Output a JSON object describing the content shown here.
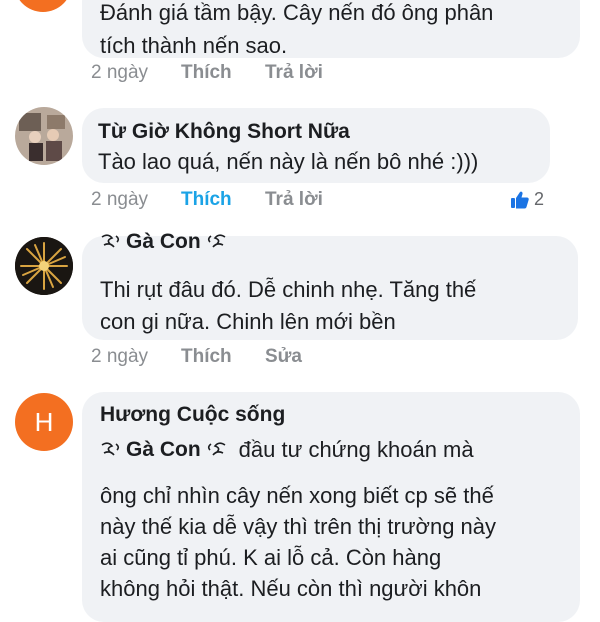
{
  "comments": [
    {
      "author": "",
      "text_lines": [
        "Đánh giá tầm bậy. Cây nến đó ông phân",
        "tích thành nến sao."
      ],
      "time": "2 ngày",
      "like_label": "Thích",
      "reply_label": "Trả lời"
    },
    {
      "author": "Từ Giờ Không Short Nữa",
      "text": "Tào lao quá, nến này là nến bô nhé :)))",
      "time": "2 ngày",
      "like_label": "Thích",
      "reply_label": "Trả lời",
      "reaction_count": "2"
    },
    {
      "mention": "Gà Con",
      "text_lines": [
        "Thi rụt đâu đó. Dễ chinh nhẹ. Tăng thế",
        "con gi nữa. Chinh lên mới bền"
      ],
      "time": "2 ngày",
      "like_label": "Thích",
      "edit_label": "Sửa"
    },
    {
      "avatar_letter": "H",
      "author": "Hương Cuộc sống",
      "mention": "Gà Con",
      "mention_text": "đầu tư chứng khoán mà",
      "text_lines": [
        "ông chỉ nhìn cây nến xong biết cp sẽ thế",
        "này thế kia dễ vậy thì trên thị trường này",
        "ai cũng tỉ phú. K ai lỗ cả. Còn hàng",
        "không hỏi thật. Nếu còn thì người khôn"
      ]
    }
  ],
  "colors": {
    "bubble": "#f0f2f5",
    "liked": "#1ba3e6",
    "muted": "#8a8d91",
    "avatar_orange": "#f36f21"
  }
}
